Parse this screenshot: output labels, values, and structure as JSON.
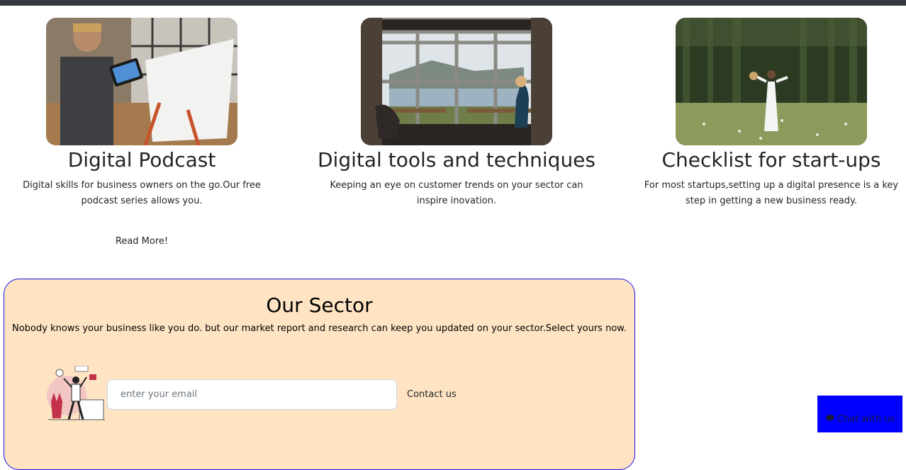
{
  "cards": [
    {
      "title": "Digital Podcast",
      "text": "Digital skills for business owners on the go.Our free podcast series allows you.",
      "link": "Read More!"
    },
    {
      "title": "Digital tools and techniques",
      "text": "Keeping an eye on customer trends on your sector can inspire inovation."
    },
    {
      "title": "Checklist for start-ups",
      "text": "For most startups,setting up a digital presence is a key step in getting a new business ready."
    }
  ],
  "sector": {
    "title": "Our Sector",
    "description": "Nobody knows your business like you do. but our market report and research can keep you updated on your sector.Select yours now.",
    "email_placeholder": "enter your email",
    "contact_label": "Contact us"
  },
  "chat": {
    "label": "Chat with us",
    "icon": "chat-bubble-icon"
  },
  "colors": {
    "sector_bg": "#ffe4c4",
    "sector_border": "#1a10e8",
    "chat_bg": "#0000ff",
    "topbar": "#343a40"
  }
}
